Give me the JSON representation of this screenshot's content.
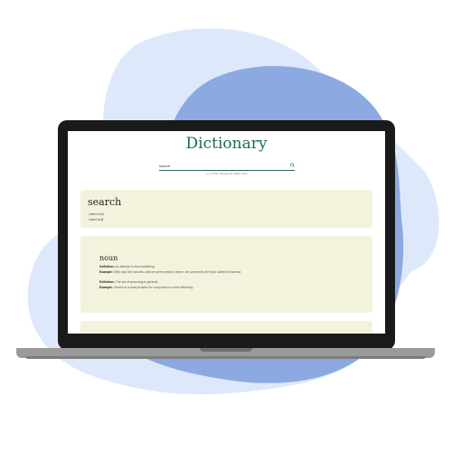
{
  "colors": {
    "accent": "#1f6d4e",
    "card": "#f3f3dd",
    "blob_light": "#dde8fb",
    "blob_dark": "#8ca9e2"
  },
  "app": {
    "title": "Dictionary",
    "search": {
      "value": "search",
      "placeholder": "",
      "hint": "e.g. Pride, Peppermill, Maize, Star"
    }
  },
  "entry": {
    "word": "search",
    "phonetics": [
      {
        "label": "Listen",
        "text": "/sɜːtʃ/"
      },
      {
        "label": "Listen",
        "text": "/sɝtʃ/"
      }
    ]
  },
  "meanings": [
    {
      "part_of_speech": "noun",
      "definitions": [
        {
          "definition_label": "Definition:",
          "definition": "An attempt to find something.",
          "example_label": "Example:",
          "example": "With only five minutes until we were meant to leave, the search for the keys started in earnest."
        },
        {
          "definition_label": "Definition:",
          "definition": "The act of searching in general.",
          "example_label": "Example:",
          "example": "Search is a hard problem for computers to solve efficiently."
        }
      ]
    }
  ]
}
